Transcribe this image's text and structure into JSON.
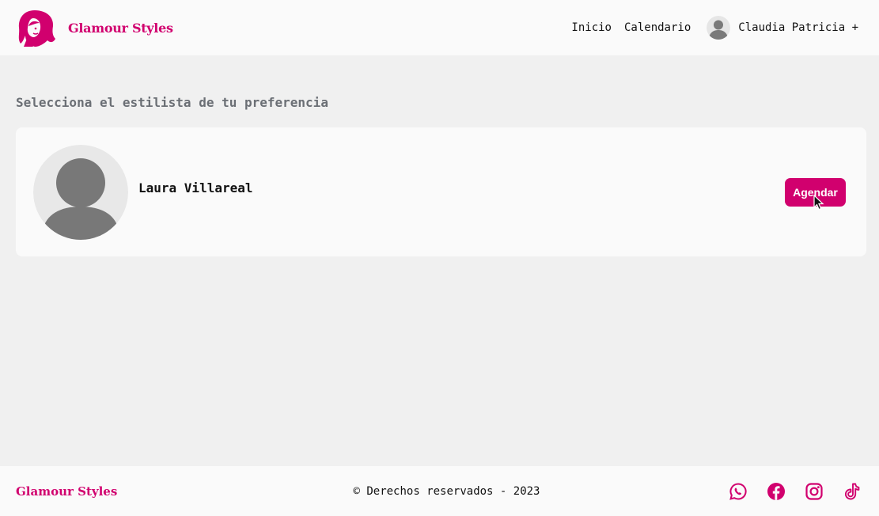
{
  "brand": {
    "name": "Glamour Styles",
    "accent_color": "#d1006e",
    "logo_icon": "woman-silhouette-logo-icon"
  },
  "nav": {
    "items": [
      {
        "label": "Inicio"
      },
      {
        "label": "Calendario"
      }
    ],
    "user": {
      "name": "Claudia Patricia +",
      "avatar_icon": "user-avatar-icon"
    }
  },
  "main": {
    "title": "Selecciona el estilista de tu preferencia",
    "stylists": [
      {
        "name": "Laura Villareal",
        "avatar_icon": "default-avatar-icon",
        "button_label": "Agendar"
      }
    ]
  },
  "footer": {
    "brand": "Glamour Styles",
    "copyright": "© Derechos reservados - 2023",
    "socials": [
      {
        "icon": "whatsapp-icon"
      },
      {
        "icon": "facebook-icon"
      },
      {
        "icon": "instagram-icon"
      },
      {
        "icon": "tiktok-icon"
      }
    ]
  }
}
